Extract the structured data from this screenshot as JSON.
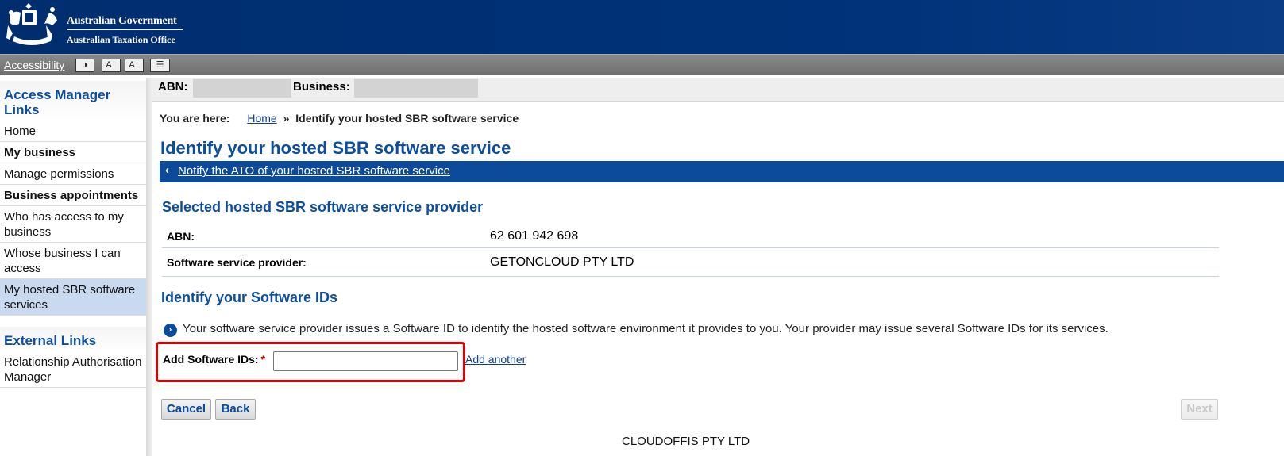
{
  "header": {
    "gov_title": "Australian Government",
    "ato_title": "Australian Taxation Office"
  },
  "toolbar": {
    "accessibility_label": "Accessibility",
    "contrast_button": "◑",
    "text_smaller_button": "A⁻",
    "text_larger_button": "A⁺",
    "text_only_button": "☰"
  },
  "sidebar": {
    "access_manager_heading": "Access Manager Links",
    "items": [
      {
        "label": "Home",
        "bold": false
      },
      {
        "label": "My business",
        "bold": true
      },
      {
        "label": "Manage permissions",
        "bold": false
      },
      {
        "label": "Business appointments",
        "bold": true
      },
      {
        "label": "Who has access to my business",
        "bold": false
      },
      {
        "label": "Whose business I can access",
        "bold": false
      },
      {
        "label": "My hosted SBR software services",
        "bold": false,
        "selected": true
      }
    ],
    "external_heading": "External Links",
    "external_items": [
      {
        "label": "Relationship Authorisation Manager"
      }
    ]
  },
  "abn_bar": {
    "abn_label": "ABN:",
    "business_label": "Business:"
  },
  "breadcrumb": {
    "prefix": "You are here:",
    "home": "Home",
    "separator": "»",
    "current": "Identify your hosted SBR software service"
  },
  "page": {
    "title": "Identify your hosted SBR software service",
    "back_link": "Notify the ATO of your hosted SBR software service",
    "back_chevron": "‹",
    "provider_section_title": "Selected hosted SBR software service provider",
    "provider_rows": [
      {
        "label": "ABN:",
        "value": "62 601 942 698"
      },
      {
        "label": "Software service provider:",
        "value": "GETONCLOUD PTY LTD"
      }
    ],
    "ids_section_title": "Identify your Software IDs",
    "info_icon": "›",
    "info_text": "Your software service provider issues a Software ID to identify the hosted software environment it provides to you. Your provider may issue several Software IDs for its services.",
    "software_ids_label": "Add Software IDs:",
    "required_marker": "*",
    "software_ids_value": "",
    "add_another": "Add another",
    "cancel": "Cancel",
    "back": "Back",
    "next": "Next",
    "bottom_text": "CLOUDOFFIS PTY LTD"
  },
  "colors": {
    "header_blue": "#002d6e",
    "link_blue": "#0c4d9f",
    "highlight_red": "#e00000"
  }
}
